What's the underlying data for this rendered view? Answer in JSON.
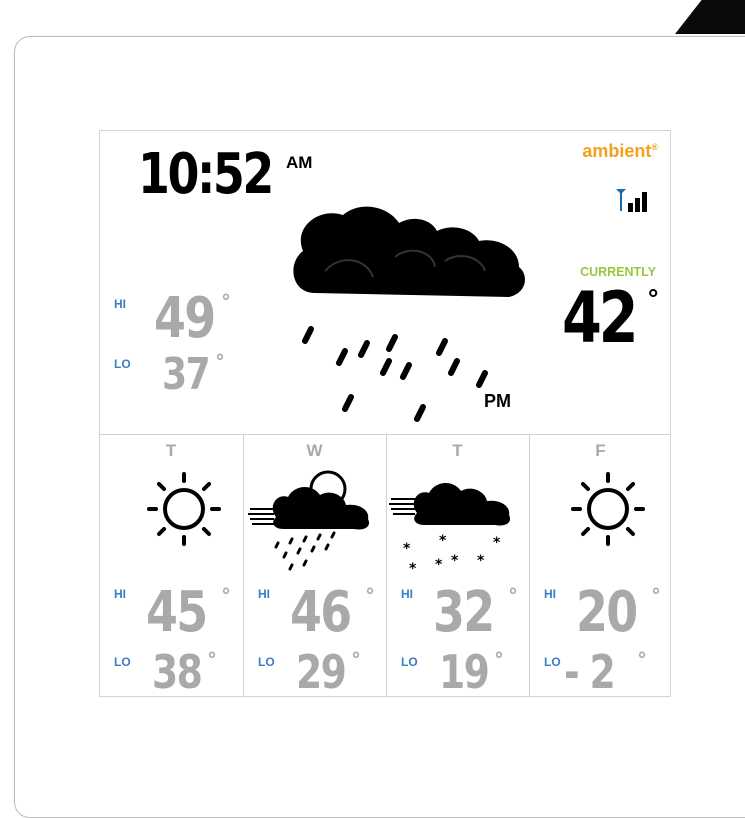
{
  "device": {
    "time": "10:52",
    "ampm": "AM",
    "brand": "ambient",
    "brand_mark": "®",
    "signal_icon": "signal-bars-icon"
  },
  "today": {
    "hi_label": "HI",
    "lo_label": "LO",
    "hi": "49",
    "lo": "37",
    "degree": "°",
    "forecast_icon": "cloud-rain-icon",
    "period": "PM"
  },
  "current": {
    "label": "CURRENTLY",
    "temp": "42",
    "degree": "°"
  },
  "forecast": [
    {
      "day": "T",
      "icon": "sun-icon",
      "hi_label": "HI",
      "lo_label": "LO",
      "hi": "45",
      "lo": "38",
      "degree": "°"
    },
    {
      "day": "W",
      "icon": "wind-cloud-sun-rain-icon",
      "hi_label": "HI",
      "lo_label": "LO",
      "hi": "46",
      "lo": "29",
      "degree": "°"
    },
    {
      "day": "T",
      "icon": "wind-cloud-snow-icon",
      "hi_label": "HI",
      "lo_label": "LO",
      "hi": "32",
      "lo": "19",
      "degree": "°"
    },
    {
      "day": "F",
      "icon": "sun-icon",
      "hi_label": "HI",
      "lo_label": "LO",
      "hi": "20",
      "lo": "- 2",
      "degree": "°"
    }
  ],
  "colors": {
    "brand": "#f4a11c",
    "label_blue": "#3b7cc6",
    "current_green": "#9bc53d",
    "segment_grey": "#a9a9a9",
    "segment_black": "#000000"
  }
}
